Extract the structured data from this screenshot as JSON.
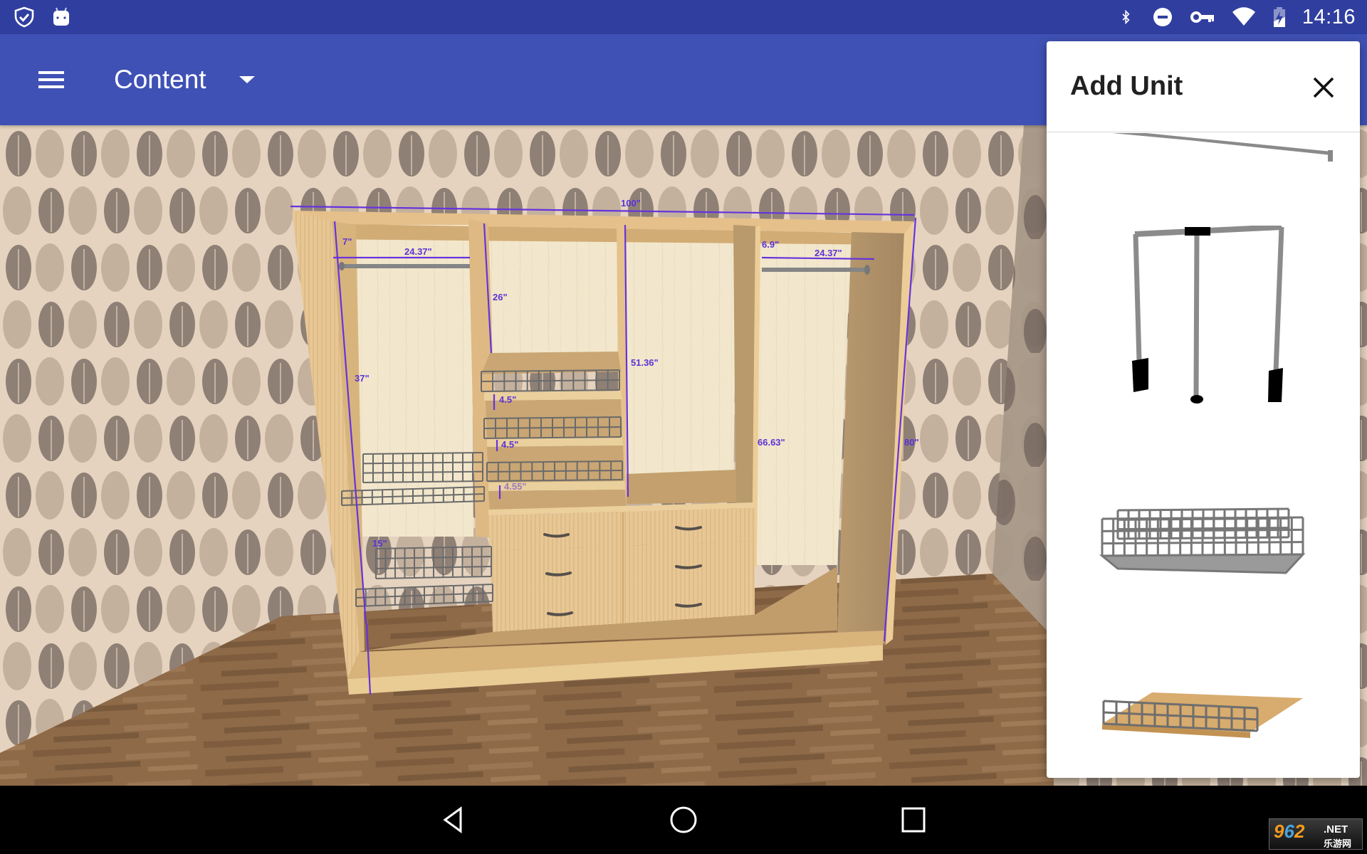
{
  "status_bar": {
    "left_icons": [
      "shield-check-icon",
      "android-icon"
    ],
    "right_icons": [
      "bluetooth-icon",
      "do-not-disturb-icon",
      "vpn-key-icon",
      "wifi-icon",
      "battery-charging-icon"
    ],
    "time": "14:16",
    "color": "#303f9f"
  },
  "app_bar": {
    "menu_icon": "hamburger-menu-icon",
    "selector_label": "Content",
    "selector_icon": "dropdown-caret-icon",
    "color": "#3f51b5"
  },
  "scene": {
    "description": "3D wardrobe in room with fern wallpaper and wood floor",
    "dimensions": {
      "total_width": "100\"",
      "left_top_gap": "7\"",
      "left_rod_width": "24.37\"",
      "middle_top_section": "26\"",
      "shelf_gap_1": "4.5\"",
      "shelf_gap_2": "4.5\"",
      "shelf_gap_3": "4.55\"",
      "left_upper_section": "37\"",
      "left_basket_gap": "15\"",
      "center_right_section": "51.36\"",
      "right_top_gap": "6.9\"",
      "right_rod_width": "24.37\"",
      "right_section_height": "66.63\"",
      "total_height": "80\""
    },
    "accent_dimension_color": "#6633dd"
  },
  "add_unit_panel": {
    "title": "Add Unit",
    "close_icon": "close-icon",
    "items": [
      {
        "name": "hanging-rod",
        "label": "Hanging rod"
      },
      {
        "name": "pull-down-wardrobe-lift",
        "label": "Pull-down wardrobe lift"
      },
      {
        "name": "wire-basket",
        "label": "Wire basket"
      },
      {
        "name": "shelf-with-rail",
        "label": "Shelf with rail"
      }
    ]
  },
  "nav_bar": {
    "buttons": [
      "back-icon",
      "home-icon",
      "recents-icon"
    ]
  },
  "watermark": {
    "digits": [
      "9",
      "6",
      "2"
    ],
    "suffix": ".NET",
    "subtitle": "乐游网"
  }
}
